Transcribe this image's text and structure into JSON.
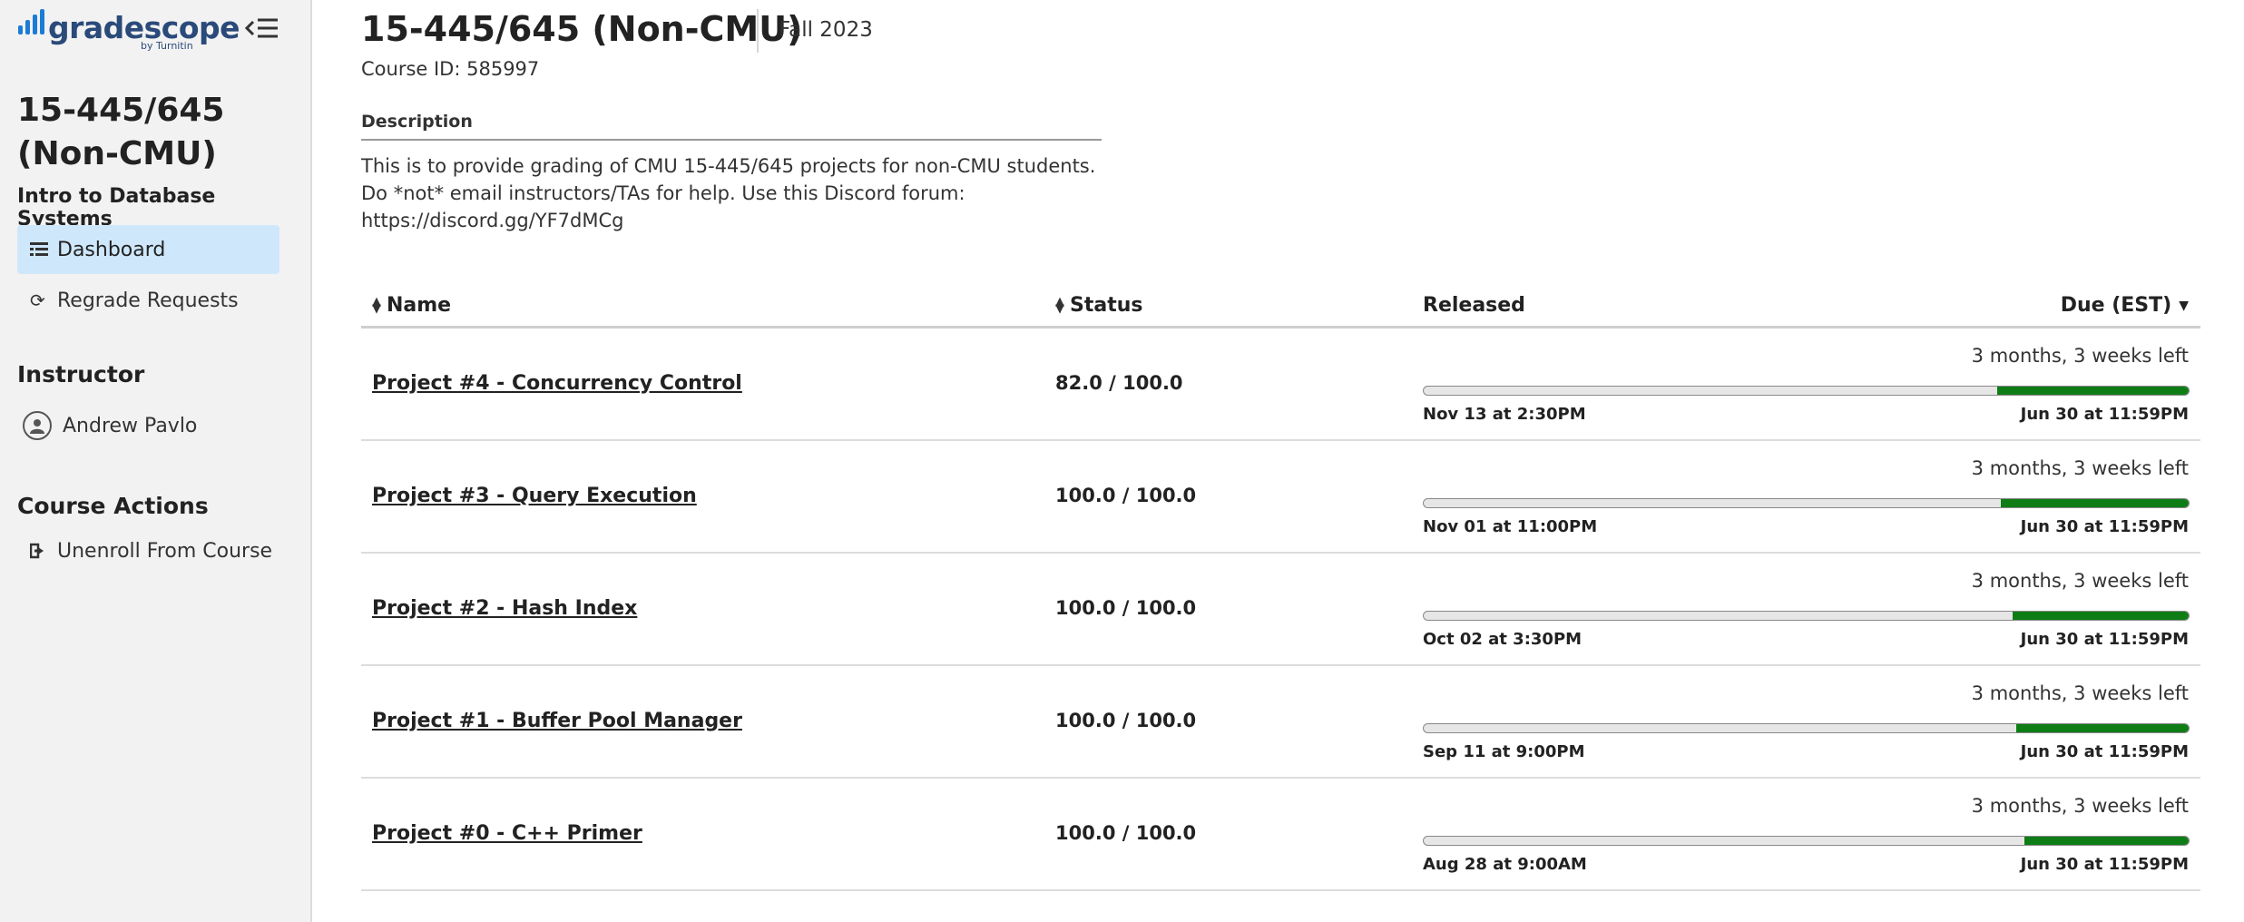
{
  "sidebar": {
    "logo_text": "gradescope",
    "logo_sub": "by Turnitin",
    "course_title": "15-445/645 (Non-CMU)",
    "course_subtitle": "Intro to Database Systems",
    "nav": [
      {
        "label": "Dashboard",
        "icon": "dashboard-icon"
      },
      {
        "label": "Regrade Requests",
        "icon": "refresh-icon"
      }
    ],
    "instructor_heading": "Instructor",
    "instructor_name": "Andrew Pavlo",
    "actions_heading": "Course Actions",
    "unenroll_label": "Unenroll From Course"
  },
  "header": {
    "title": "15-445/645 (Non-CMU)",
    "term": "Fall 2023",
    "course_id": "Course ID: 585997"
  },
  "description": {
    "heading": "Description",
    "body": "This is to provide grading of CMU 15-445/645 projects for non-CMU students. Do *not* email instructors/TAs for help. Use this Discord forum: https://discord.gg/YF7dMCg"
  },
  "table": {
    "headers": {
      "name": "Name",
      "status": "Status",
      "released": "Released",
      "due": "Due (EST)"
    },
    "rows": [
      {
        "name": "Project #4 - Concurrency Control",
        "status": "82.0 / 100.0",
        "time_left": "3 months, 3 weeks left",
        "released": "Nov 13 at 2:30PM",
        "due": "Jun 30 at 11:59PM",
        "remaining_fraction": 0.25
      },
      {
        "name": "Project #3 - Query Execution",
        "status": "100.0 / 100.0",
        "time_left": "3 months, 3 weeks left",
        "released": "Nov 01 at 11:00PM",
        "due": "Jun 30 at 11:59PM",
        "remaining_fraction": 0.245
      },
      {
        "name": "Project #2 - Hash Index",
        "status": "100.0 / 100.0",
        "time_left": "3 months, 3 weeks left",
        "released": "Oct 02 at 3:30PM",
        "due": "Jun 30 at 11:59PM",
        "remaining_fraction": 0.23
      },
      {
        "name": "Project #1 - Buffer Pool Manager",
        "status": "100.0 / 100.0",
        "time_left": "3 months, 3 weeks left",
        "released": "Sep 11 at 9:00PM",
        "due": "Jun 30 at 11:59PM",
        "remaining_fraction": 0.225
      },
      {
        "name": "Project #0 - C++ Primer",
        "status": "100.0 / 100.0",
        "time_left": "3 months, 3 weeks left",
        "released": "Aug 28 at 9:00AM",
        "due": "Jun 30 at 11:59PM",
        "remaining_fraction": 0.215
      }
    ]
  },
  "colors": {
    "progress": "#0f7d16",
    "active_nav": "#cfe7fb",
    "brand": "#1c7cd5"
  }
}
